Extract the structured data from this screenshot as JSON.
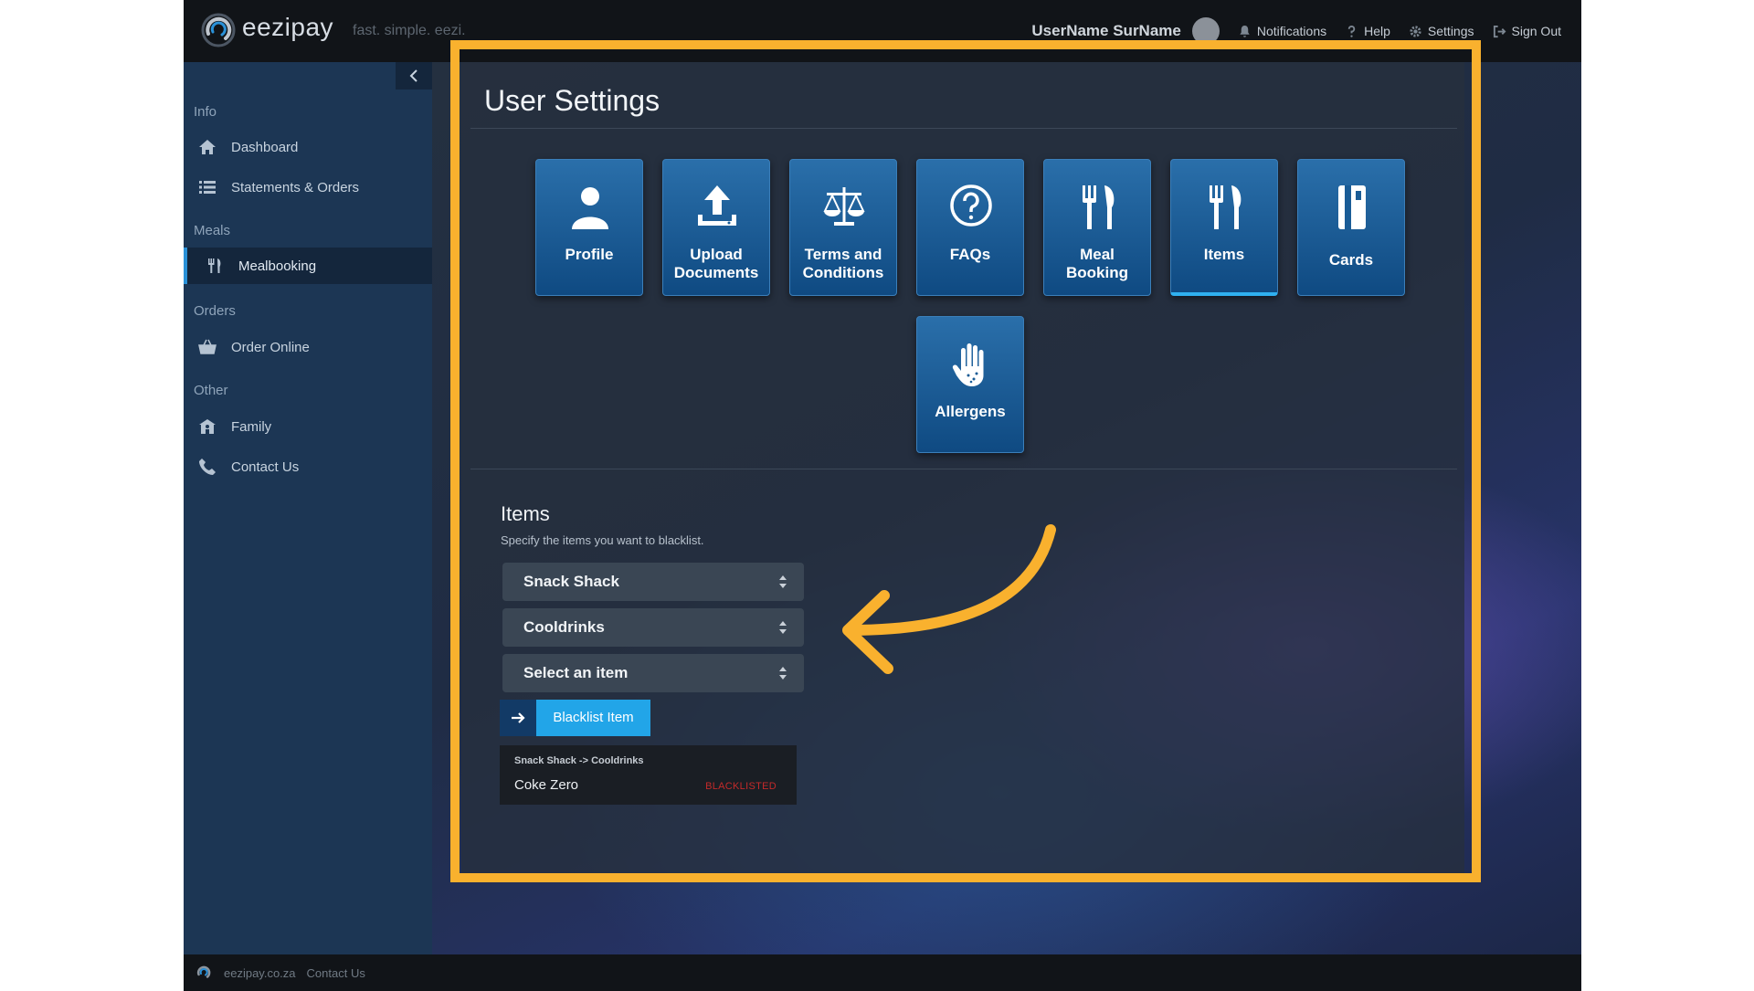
{
  "app": {
    "brand": "eezipay",
    "tagline": "fast. simple. eezi."
  },
  "topbar": {
    "username": "UserName SurName",
    "notifications": "Notifications",
    "help": "Help",
    "settings": "Settings",
    "sign_out": "Sign Out"
  },
  "sidebar": {
    "sections": [
      {
        "title": "Info",
        "items": [
          {
            "label": "Dashboard",
            "icon": "home-icon"
          },
          {
            "label": "Statements & Orders",
            "icon": "list-icon"
          }
        ]
      },
      {
        "title": "Meals",
        "items": [
          {
            "label": "Mealbooking",
            "icon": "fork-knife-icon",
            "active": true
          }
        ]
      },
      {
        "title": "Orders",
        "items": [
          {
            "label": "Order Online",
            "icon": "basket-icon"
          }
        ]
      },
      {
        "title": "Other",
        "items": [
          {
            "label": "Family",
            "icon": "family-icon"
          },
          {
            "label": "Contact Us",
            "icon": "phone-icon"
          }
        ]
      }
    ]
  },
  "page": {
    "title": "User Settings"
  },
  "tiles": [
    {
      "label": "Profile",
      "icon": "person-icon"
    },
    {
      "label_line1": "Upload",
      "label_line2": "Documents",
      "icon": "upload-icon"
    },
    {
      "label_line1": "Terms and",
      "label_line2": "Conditions",
      "icon": "scales-icon"
    },
    {
      "label": "FAQs",
      "icon": "question-icon"
    },
    {
      "label_line1": "Meal",
      "label_line2": "Booking",
      "icon": "fork-knife-icon"
    },
    {
      "label": "Items",
      "icon": "fork-knife-icon",
      "active": true
    },
    {
      "label": "Cards",
      "icon": "card-icon"
    },
    {
      "label": "Allergens",
      "icon": "hand-icon"
    }
  ],
  "items_section": {
    "title": "Items",
    "description": "Specify the items you want to blacklist.",
    "select_shop": "Snack Shack",
    "select_category": "Cooldrinks",
    "select_item": "Select an item",
    "blacklist_button": "Blacklist Item",
    "blacklisted": [
      {
        "path": "Snack Shack -> Cooldrinks",
        "name": "Coke Zero",
        "status": "BLACKLISTED"
      }
    ]
  },
  "footer": {
    "site": "eezipay.co.za",
    "contact": "Contact Us"
  },
  "colors": {
    "accent": "#22a5e8",
    "highlight": "#f9b12e",
    "tile": "#1a5c96",
    "danger": "#c42a2a"
  }
}
